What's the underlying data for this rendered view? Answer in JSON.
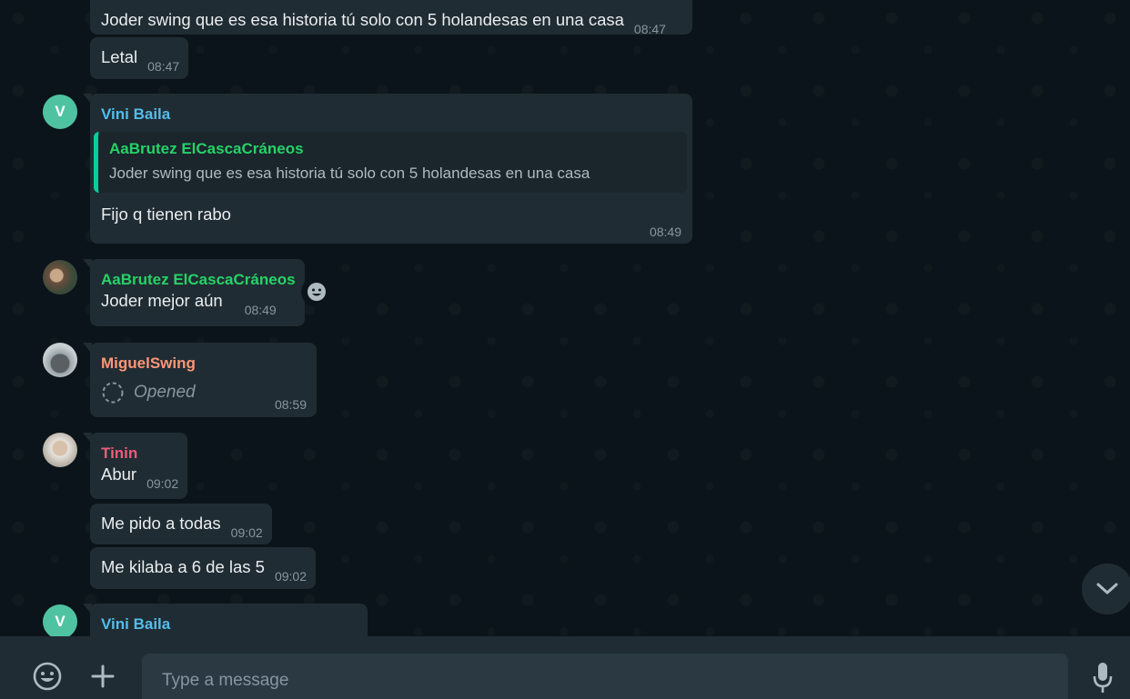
{
  "messages": [
    {
      "text": "Joder swing que es esa historia tú solo con 5 holandesas en una casa",
      "time": "08:47"
    },
    {
      "text": "Letal",
      "time": "08:47"
    },
    {
      "sender": "Vini Baila",
      "avatar_letter": "V",
      "quote_sender": "AaBrutez ElCascaCráneos",
      "quote_text": "Joder swing que es esa historia tú solo con 5 holandesas en una casa",
      "text": "Fijo q tienen rabo",
      "time": "08:49"
    },
    {
      "sender": "AaBrutez ElCascaCráneos",
      "text": "Joder mejor aún",
      "time": "08:49"
    },
    {
      "sender": "MiguelSwing",
      "text": "Opened",
      "time": "08:59"
    },
    {
      "sender": "Tinin",
      "text": "Abur",
      "time": "09:02"
    },
    {
      "text": "Me pido a todas",
      "time": "09:02"
    },
    {
      "text": "Me kilaba a 6 de las 5",
      "time": "09:02"
    },
    {
      "sender": "Vini Baila",
      "avatar_letter": "V"
    }
  ],
  "composer": {
    "placeholder": "Type a message"
  },
  "colors": {
    "background": "#0b141a",
    "bubble": "#202c33",
    "vini": "#53bdeb",
    "aabrutez": "#25d366",
    "miguel": "#fc9775",
    "tinin": "#ef5b7a"
  },
  "icons": [
    "emoji-icon",
    "plus-icon",
    "mic-icon",
    "chevron-down-icon",
    "smiley-react-icon",
    "view-once-icon"
  ]
}
